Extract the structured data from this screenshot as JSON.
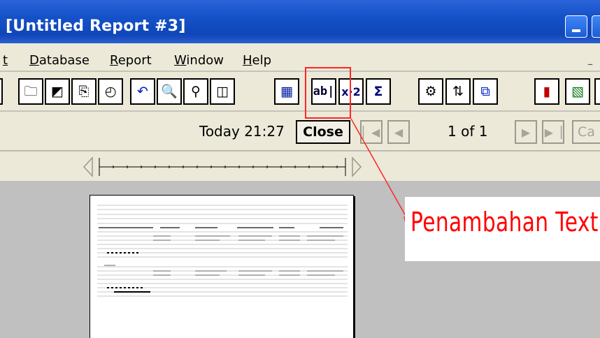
{
  "window": {
    "title": "[Untitled Report #3]"
  },
  "menu": {
    "items": [
      {
        "label": "t"
      },
      {
        "label": "Database"
      },
      {
        "label": "Report"
      },
      {
        "label": "Window"
      },
      {
        "label": "Help"
      }
    ],
    "min_glyph": "–"
  },
  "toolbar": {
    "buttons": [
      {
        "name": "open-icon",
        "glyph": "🗀"
      },
      {
        "name": "chart-wizard-icon",
        "glyph": "◩"
      },
      {
        "name": "report-format-icon",
        "glyph": "⎘"
      },
      {
        "name": "clock-icon",
        "glyph": "◴"
      },
      {
        "name": "undo-icon",
        "glyph": "↶"
      },
      {
        "name": "zoom-icon",
        "glyph": "🔍"
      },
      {
        "name": "find-icon",
        "glyph": "⚲"
      },
      {
        "name": "select-expert-icon",
        "glyph": "◫"
      },
      {
        "name": "insert-field-icon",
        "glyph": "▦"
      },
      {
        "name": "insert-text-object-icon",
        "glyph": "ab|"
      },
      {
        "name": "formula-icon",
        "glyph": "x·2"
      },
      {
        "name": "sum-icon",
        "glyph": "Σ"
      },
      {
        "name": "group-icon",
        "glyph": "⚙"
      },
      {
        "name": "sort-icon",
        "glyph": "⇅"
      },
      {
        "name": "subreport-icon",
        "glyph": "⧉"
      },
      {
        "name": "insert-chart-icon",
        "glyph": "▮"
      },
      {
        "name": "insert-picture-icon",
        "glyph": "▧"
      }
    ]
  },
  "navigation": {
    "timestamp": "Today 21:27",
    "close_label": "Close",
    "page_info": "1 of 1",
    "cancel_partial": "Ca"
  },
  "annotation": {
    "callout_text": "Penambahan Text",
    "color": "#ff0000"
  },
  "colors": {
    "titlebar": "#1451c8",
    "chrome": "#ece9d8",
    "workspace": "#c0c0c0",
    "annotation": "#ff0000"
  }
}
